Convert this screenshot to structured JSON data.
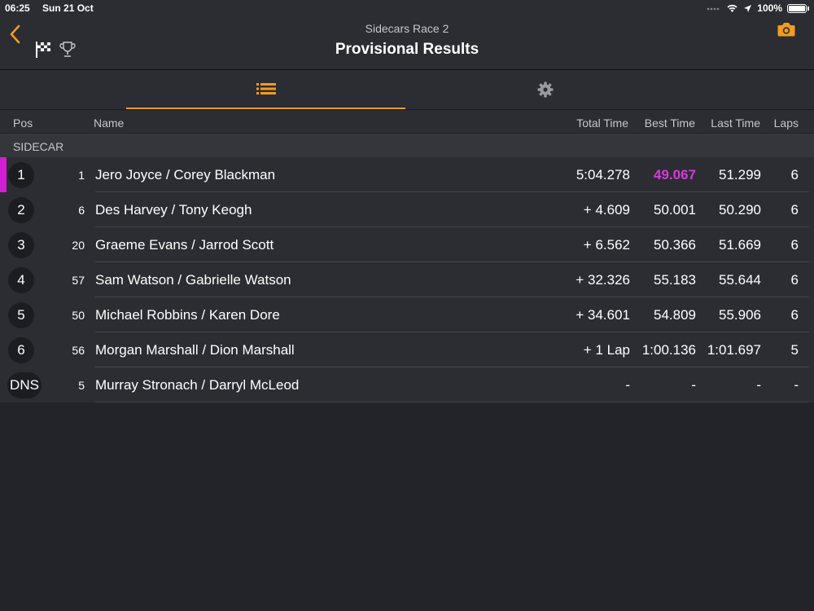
{
  "status": {
    "time": "06:25",
    "date": "Sun 21 Oct",
    "battery": "100%"
  },
  "header": {
    "subtitle": "Sidecars Race 2",
    "title": "Provisional Results"
  },
  "tabs": [
    {
      "name": "results-list",
      "icon": "list-icon"
    },
    {
      "name": "settings",
      "icon": "gear-icon"
    }
  ],
  "columns": {
    "pos": "Pos",
    "name": "Name",
    "total": "Total Time",
    "best": "Best Time",
    "last": "Last Time",
    "laps": "Laps"
  },
  "section": {
    "label": "SIDECAR"
  },
  "rows": [
    {
      "pos": "1",
      "num": "1",
      "name": "Jero Joyce / Corey Blackman",
      "total": "5:04.278",
      "best": "49.067",
      "last": "51.299",
      "laps": "6"
    },
    {
      "pos": "2",
      "num": "6",
      "name": "Des Harvey / Tony Keogh",
      "total": "+ 4.609",
      "best": "50.001",
      "last": "50.290",
      "laps": "6"
    },
    {
      "pos": "3",
      "num": "20",
      "name": "Graeme Evans / Jarrod Scott",
      "total": "+ 6.562",
      "best": "50.366",
      "last": "51.669",
      "laps": "6"
    },
    {
      "pos": "4",
      "num": "57",
      "name": "Sam Watson / Gabrielle Watson",
      "total": "+ 32.326",
      "best": "55.183",
      "last": "55.644",
      "laps": "6"
    },
    {
      "pos": "5",
      "num": "50",
      "name": "Michael Robbins / Karen Dore",
      "total": "+ 34.601",
      "best": "54.809",
      "last": "55.906",
      "laps": "6"
    },
    {
      "pos": "6",
      "num": "56",
      "name": "Morgan Marshall / Dion Marshall",
      "total": "+ 1 Lap",
      "best": "1:00.136",
      "last": "1:01.697",
      "laps": "5"
    },
    {
      "pos": "DNS",
      "num": "5",
      "name": "Murray Stronach / Darryl McLeod",
      "total": "-",
      "best": "-",
      "last": "-",
      "laps": "-"
    }
  ],
  "colors": {
    "accent": "#f39c1f",
    "fastest": "#d839d9",
    "background": "#222429"
  }
}
